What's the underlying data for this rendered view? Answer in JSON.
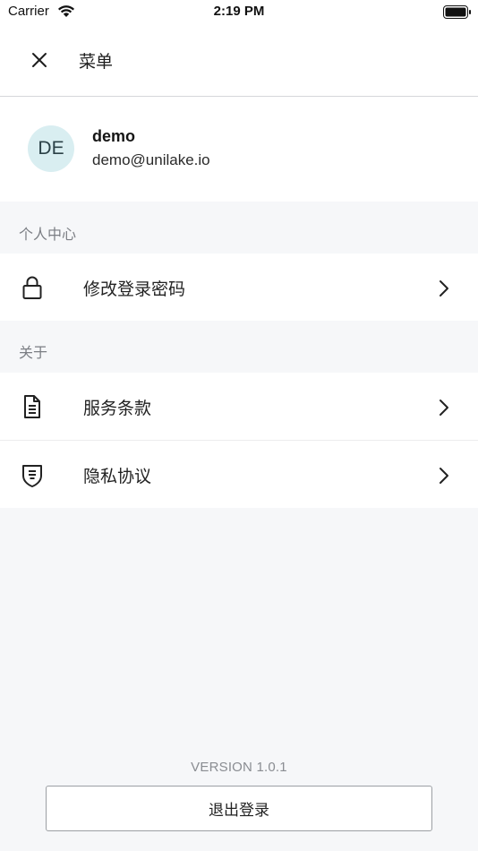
{
  "status_bar": {
    "carrier": "Carrier",
    "time": "2:19 PM"
  },
  "header": {
    "title": "菜单",
    "close_icon": "close-icon"
  },
  "profile": {
    "avatar_initials": "DE",
    "avatar_color": "#d9eef1",
    "name": "demo",
    "email": "demo@unilake.io"
  },
  "sections": {
    "personal_center": {
      "title": "个人中心",
      "items": [
        {
          "label": "修改登录密码",
          "icon": "lock-icon"
        }
      ]
    },
    "about": {
      "title": "关于",
      "items": [
        {
          "label": "服务条款",
          "icon": "document-icon"
        },
        {
          "label": "隐私协议",
          "icon": "shield-icon"
        }
      ]
    }
  },
  "footer": {
    "version": "VERSION 1.0.1",
    "logout_label": "退出登录"
  }
}
